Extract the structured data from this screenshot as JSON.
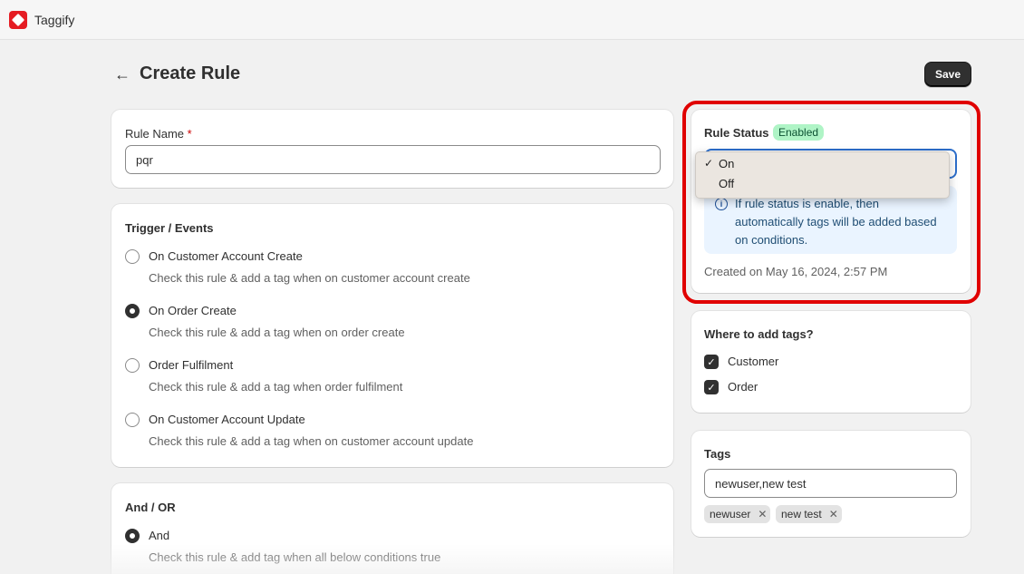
{
  "app": {
    "name": "Taggify"
  },
  "header": {
    "title": "Create Rule",
    "save_label": "Save"
  },
  "rule_name": {
    "label": "Rule Name",
    "required_marker": "*",
    "value": "pqr"
  },
  "trigger": {
    "title": "Trigger / Events",
    "options": [
      {
        "label": "On Customer Account Create",
        "help": "Check this rule & add a tag when on customer account create",
        "checked": false
      },
      {
        "label": "On Order Create",
        "help": "Check this rule & add a tag when on order create",
        "checked": true
      },
      {
        "label": "Order Fulfilment",
        "help": "Check this rule & add a tag when order fulfilment",
        "checked": false
      },
      {
        "label": "On Customer Account Update",
        "help": "Check this rule & add a tag when on customer account update",
        "checked": false
      }
    ]
  },
  "and_or": {
    "title": "And / OR",
    "options": [
      {
        "label": "And",
        "help": "Check this rule & add tag when all below conditions true",
        "checked": true
      }
    ]
  },
  "rule_status": {
    "title": "Rule Status",
    "badge": "Enabled",
    "dropdown": {
      "options": [
        {
          "check": "✓",
          "label": "On",
          "selected": true
        },
        {
          "check": "",
          "label": "Off",
          "selected": false
        }
      ]
    },
    "info": "If rule status is enable, then automatically tags will be added based on conditions.",
    "created": "Created on May 16, 2024, 2:57 PM"
  },
  "where_tags": {
    "title": "Where to add tags?",
    "options": [
      {
        "label": "Customer",
        "checked": true
      },
      {
        "label": "Order",
        "checked": true
      }
    ]
  },
  "tags": {
    "title": "Tags",
    "input_value": "newuser,new test",
    "chips": [
      "newuser",
      "new test"
    ],
    "remove_glyph": "✕"
  },
  "colors": {
    "highlight": "#e00000",
    "badge_bg": "#aff4c6",
    "primary": "#303030"
  }
}
